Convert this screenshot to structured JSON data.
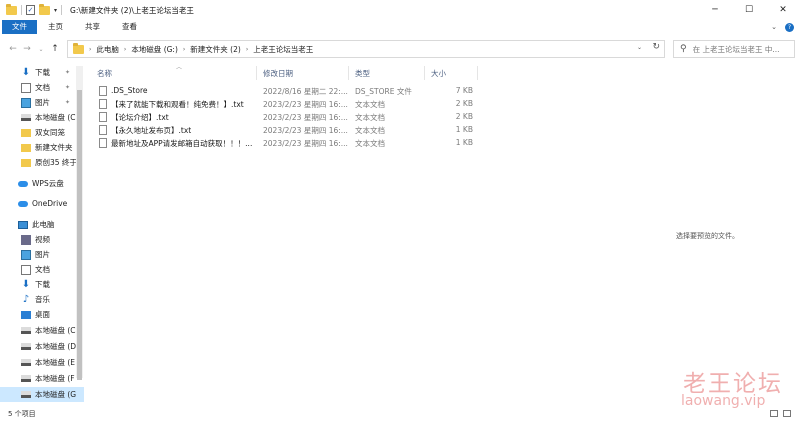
{
  "window": {
    "title": "G:\\新建文件夹 (2)\\上老王论坛当老王",
    "controls": {
      "minimize": "─",
      "maximize": "☐",
      "close": "✕"
    }
  },
  "ribbon": {
    "tabs": [
      "文件",
      "主页",
      "共享",
      "查看"
    ],
    "expand": "⌄",
    "help": "?"
  },
  "address": {
    "crumbs": [
      "此电脑",
      "本地磁盘 (G:)",
      "新建文件夹 (2)",
      "上老王论坛当老王"
    ],
    "search_placeholder": "在 上老王论坛当老王 中..."
  },
  "nav": {
    "items": [
      {
        "label": "下载",
        "icon": "download-icon",
        "pinned": true
      },
      {
        "label": "文档",
        "icon": "document-icon",
        "pinned": true
      },
      {
        "label": "图片",
        "icon": "picture-icon",
        "pinned": true
      },
      {
        "label": "本地磁盘 (C",
        "icon": "drive-icon"
      },
      {
        "label": "双女同笼",
        "icon": "folder-icon"
      },
      {
        "label": "新建文件夹",
        "icon": "folder-icon"
      },
      {
        "label": "原创35 终于",
        "icon": "folder-icon"
      },
      {
        "label": "WPS云盘",
        "icon": "cloud-icon"
      },
      {
        "label": "OneDrive",
        "icon": "onedrive-icon"
      },
      {
        "label": "此电脑",
        "icon": "pc-icon"
      },
      {
        "label": "视频",
        "icon": "video-icon"
      },
      {
        "label": "图片",
        "icon": "picture-icon"
      },
      {
        "label": "文档",
        "icon": "document-icon"
      },
      {
        "label": "下载",
        "icon": "download-icon"
      },
      {
        "label": "音乐",
        "icon": "music-icon"
      },
      {
        "label": "桌面",
        "icon": "desktop-icon"
      },
      {
        "label": "本地磁盘 (C",
        "icon": "drive-icon"
      },
      {
        "label": "本地磁盘 (D",
        "icon": "drive-icon"
      },
      {
        "label": "本地磁盘 (E",
        "icon": "drive-icon"
      },
      {
        "label": "本地磁盘 (F",
        "icon": "drive-icon"
      },
      {
        "label": "本地磁盘 (G",
        "icon": "drive-icon",
        "selected": true
      }
    ]
  },
  "files": {
    "columns": [
      "名称",
      "修改日期",
      "类型",
      "大小"
    ],
    "rows": [
      {
        "name": ".DS_Store",
        "date": "2022/8/16 星期二 22:...",
        "type": "DS_STORE 文件",
        "size": "7 KB"
      },
      {
        "name": "【来了就能下载和观看！纯免费！】.txt",
        "date": "2023/2/23 星期四 16:...",
        "type": "文本文档",
        "size": "2 KB"
      },
      {
        "name": "【论坛介绍】.txt",
        "date": "2023/2/23 星期四 16:...",
        "type": "文本文档",
        "size": "2 KB"
      },
      {
        "name": "【永久地址发布页】.txt",
        "date": "2023/2/23 星期四 16:...",
        "type": "文本文档",
        "size": "1 KB"
      },
      {
        "name": "最新地址及APP请发邮箱自动获取！！！...",
        "date": "2023/2/23 星期四 16:...",
        "type": "文本文档",
        "size": "1 KB"
      }
    ]
  },
  "preview": {
    "text": "选择要预览的文件。"
  },
  "status": {
    "count": "5 个项目"
  },
  "watermark": {
    "line1": "老王论坛",
    "line2": "laowang.vip"
  }
}
